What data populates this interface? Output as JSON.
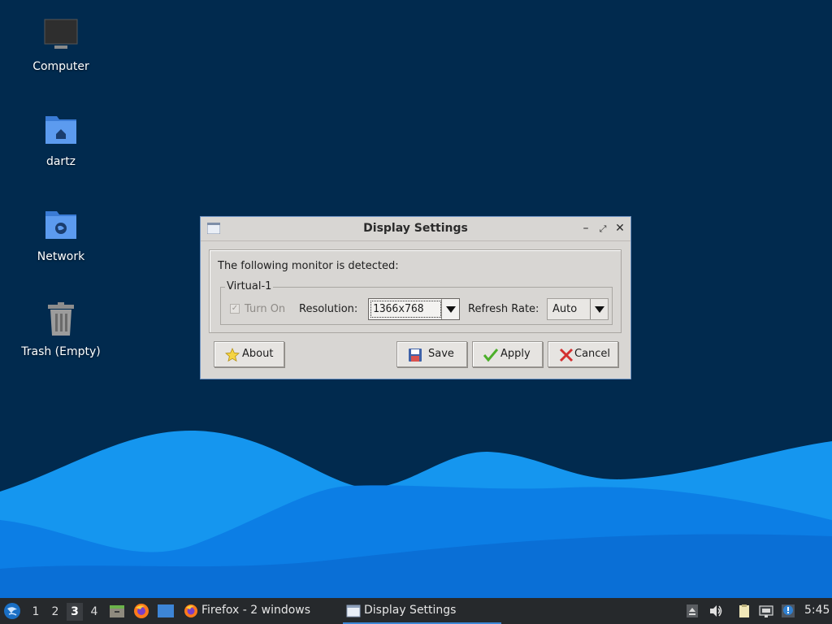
{
  "desktop": {
    "icons": [
      {
        "label": "Computer",
        "icon": "computer-icon"
      },
      {
        "label": "dartz",
        "icon": "home-folder-icon"
      },
      {
        "label": "Network",
        "icon": "network-folder-icon"
      },
      {
        "label": "Trash (Empty)",
        "icon": "trash-icon"
      }
    ]
  },
  "dialog": {
    "title": "Display Settings",
    "detected_text": "The following monitor is detected:",
    "monitor_name": "Virtual-1",
    "turn_on_label": "Turn On",
    "turn_on_checked": true,
    "resolution_label": "Resolution:",
    "resolution_value": "1366x768",
    "refresh_rate_label": "Refresh Rate:",
    "refresh_rate_value": "Auto",
    "buttons": {
      "about": "About",
      "save": "Save",
      "apply": "Apply",
      "cancel": "Cancel"
    }
  },
  "taskbar": {
    "workspaces": [
      "1",
      "2",
      "3",
      "4"
    ],
    "active_workspace": "3",
    "tasks": [
      {
        "label": "Firefox - 2 windows",
        "icon": "firefox-icon"
      },
      {
        "label": "Display Settings",
        "icon": "window-icon"
      }
    ],
    "clock": "5:45"
  },
  "colors": {
    "desktop_bg": "#012a4e",
    "wave_light": "#1a9bf0",
    "wave_dark": "#0b6fd8",
    "accent": "#3c87d6"
  }
}
